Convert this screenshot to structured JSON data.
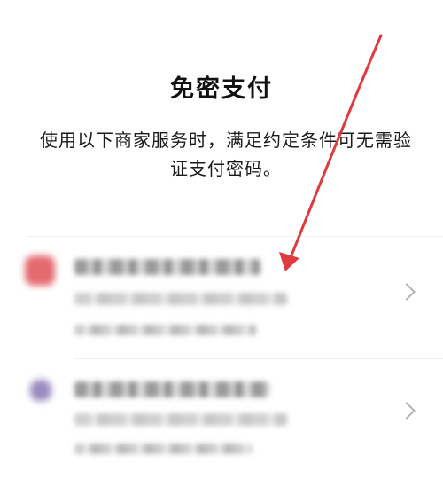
{
  "header": {
    "title": "免密支付",
    "description": "使用以下商家服务时，满足约定条件可无需验证支付密码。"
  },
  "merchants": [
    {
      "name": "",
      "detail": "",
      "date": ""
    },
    {
      "name": "",
      "detail": "",
      "date": ""
    }
  ],
  "icons": {
    "row_arrow": "chevron-right-icon"
  },
  "colors": {
    "annotation": "#e0393e",
    "chevron": "#b3b3b3"
  }
}
